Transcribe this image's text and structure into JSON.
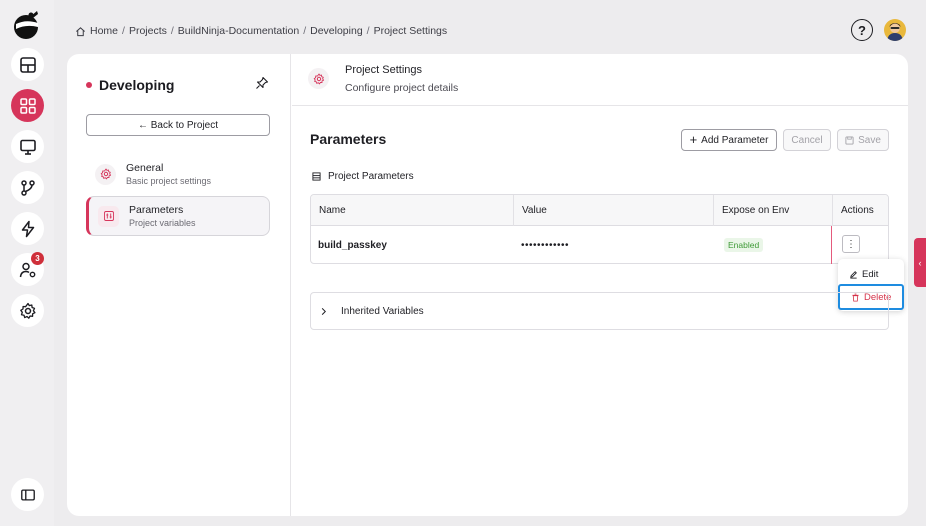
{
  "breadcrumb": {
    "items": [
      "Home",
      "Projects",
      "BuildNinja-Documentation",
      "Developing",
      "Project Settings"
    ]
  },
  "rail": {
    "notification_count": "3"
  },
  "sidebar": {
    "title": "Developing",
    "back_label": "← Back to Project",
    "items": [
      {
        "label": "General",
        "sub": "Basic project settings"
      },
      {
        "label": "Parameters",
        "sub": "Project variables"
      }
    ]
  },
  "header": {
    "title": "Project Settings",
    "subtitle": "Configure project details"
  },
  "parameters": {
    "title": "Parameters",
    "add_label": "Add Parameter",
    "cancel_label": "Cancel",
    "save_label": "Save",
    "section_label": "Project Parameters",
    "columns": [
      "Name",
      "Value",
      "Expose on Env",
      "Actions"
    ],
    "rows": [
      {
        "name": "build_passkey",
        "value": "••••••••••••",
        "expose": "Enabled"
      }
    ]
  },
  "menu": {
    "edit_label": "Edit",
    "delete_label": "Delete"
  },
  "inherited": {
    "label": "Inherited Variables"
  },
  "colors": {
    "accent": "#d6355b",
    "enabled_text": "#3f9a37",
    "delete_text": "#d5344a",
    "highlight": "#1e8ce0"
  }
}
